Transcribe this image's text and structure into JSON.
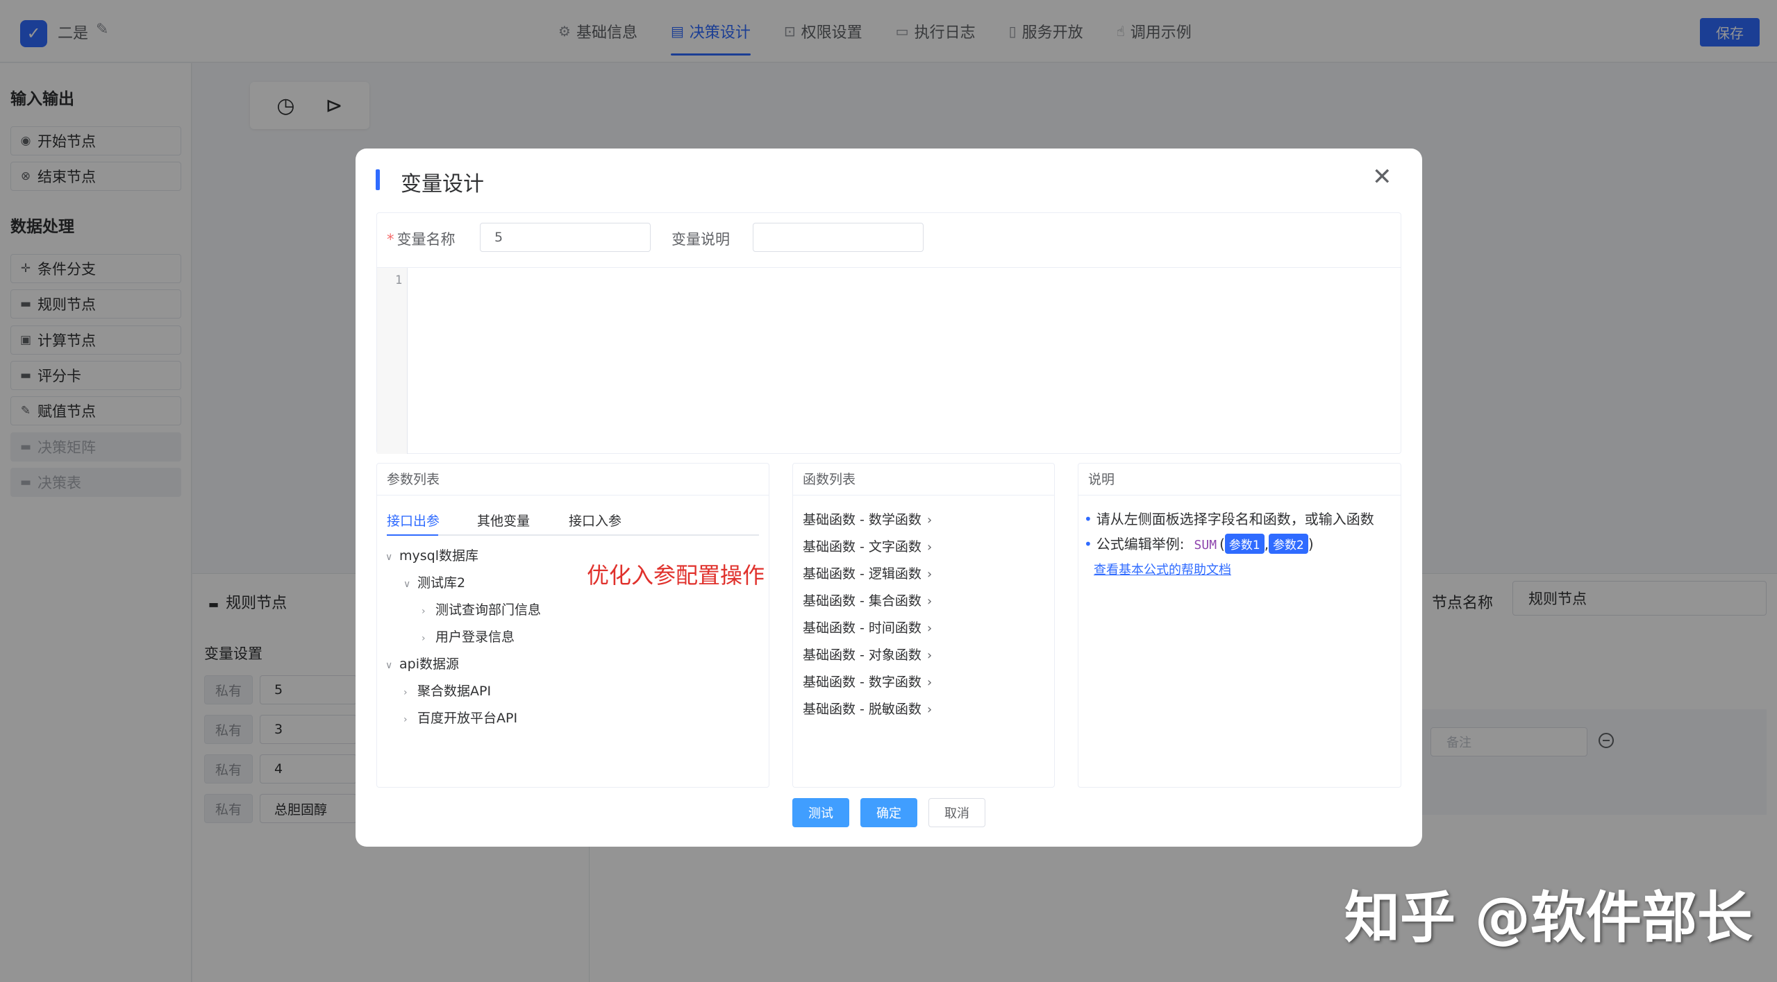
{
  "app": {
    "title": "二是"
  },
  "tabs": [
    {
      "label": "基础信息",
      "icon": "gear-icon"
    },
    {
      "label": "决策设计",
      "icon": "design-icon",
      "active": true
    },
    {
      "label": "权限设置",
      "icon": "lock-icon"
    },
    {
      "label": "执行日志",
      "icon": "document-icon"
    },
    {
      "label": "服务开放",
      "icon": "book-icon"
    },
    {
      "label": "调用示例",
      "icon": "thumb-icon"
    }
  ],
  "toolbar": {
    "save_label": "保存"
  },
  "sidebar": {
    "section_io": "输入输出",
    "section_data": "数据处理",
    "items": [
      {
        "label": "开始节点",
        "icon": "play-icon"
      },
      {
        "label": "结束节点",
        "icon": "stop-icon"
      },
      {
        "label": "条件分支",
        "icon": "branch-icon"
      },
      {
        "label": "规则节点",
        "icon": "card-icon"
      },
      {
        "label": "计算节点",
        "icon": "calculator-icon"
      },
      {
        "label": "评分卡",
        "icon": "card-icon"
      },
      {
        "label": "赋值节点",
        "icon": "edit-icon"
      },
      {
        "label": "决策矩阵",
        "icon": "card-icon",
        "disabled": true
      },
      {
        "label": "决策表",
        "icon": "card-icon",
        "disabled": true
      }
    ]
  },
  "canvas": {
    "toolbar_icons": [
      "clock-icon",
      "play-icon"
    ]
  },
  "bottom_panel": {
    "title": "规则节点",
    "var_settings_label": "变量设置",
    "variables": [
      {
        "scope": "私有",
        "value": "5"
      },
      {
        "scope": "私有",
        "value": "3"
      },
      {
        "scope": "私有",
        "value": "4"
      },
      {
        "scope": "私有",
        "value": "总胆固醇"
      }
    ],
    "node_name_label": "节点名称",
    "node_name_value": "规则节点",
    "remark_placeholder": "备注"
  },
  "modal": {
    "title": "变量设计",
    "name_label": "变量名称",
    "name_value": "5",
    "desc_label": "变量说明",
    "desc_value": "",
    "editor_line_number": "1",
    "params_panel": {
      "title": "参数列表",
      "tabs": [
        "接口出参",
        "其他变量",
        "接口入参"
      ],
      "tree": [
        {
          "label": "mysql数据库",
          "expanded": true
        },
        {
          "label": "测试库2",
          "expanded": true
        },
        {
          "label": "测试查询部门信息",
          "expanded": false
        },
        {
          "label": "用户登录信息",
          "expanded": false
        },
        {
          "label": "api数据源",
          "expanded": true
        },
        {
          "label": "聚合数据API",
          "expanded": false
        },
        {
          "label": "百度开放平台API",
          "expanded": false
        }
      ],
      "annotation": "优化入参配置操作"
    },
    "functions_panel": {
      "title": "函数列表",
      "items": [
        "基础函数 - 数学函数",
        "基础函数 - 文字函数",
        "基础函数 - 逻辑函数",
        "基础函数 - 集合函数",
        "基础函数 - 时间函数",
        "基础函数 - 对象函数",
        "基础函数 - 数字函数",
        "基础函数 - 脱敏函数"
      ]
    },
    "help_panel": {
      "title": "说明",
      "tip1": "请从左侧面板选择字段名和函数，或输入函数",
      "tip2_prefix": "公式编辑举例:",
      "tip2_fn": "SUM",
      "tip2_open": "(",
      "tip2_arg1": "参数1",
      "tip2_sep": ",",
      "tip2_arg2": "参数2",
      "tip2_close": ")",
      "link": "查看基本公式的帮助文档"
    },
    "buttons": {
      "test": "测试",
      "ok": "确定",
      "cancel": "取消"
    }
  },
  "watermark": "知乎 @软件部长"
}
